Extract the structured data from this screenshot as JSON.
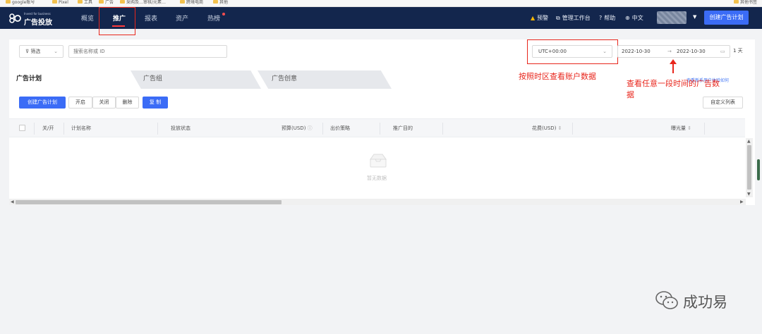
{
  "bookmarks": [
    "google账号",
    "Pixel",
    "工具",
    "广告",
    "采购及…审核/元素…",
    "跨境电商",
    "其他"
  ],
  "bookmarks_right": "其他书签",
  "logo": {
    "tagline": "Invest for business",
    "name": "广告投放"
  },
  "nav": {
    "items": [
      "概览",
      "推广",
      "报表",
      "资产",
      "热榜"
    ],
    "active": "推广",
    "right": {
      "alert": "预警",
      "workbench": "管理工作台",
      "help": "帮助",
      "language": "中文"
    },
    "create_button": "创建广告计划"
  },
  "filter": {
    "filter_label": "筛选",
    "search_placeholder": "搜索名称或 ID",
    "timezone": "UTC+00:00",
    "date_start": "2022-10-30",
    "date_sep": "→",
    "date_end": "2022-10-30",
    "days": "1 天"
  },
  "annotations": {
    "timezone_note": "按照时区查看账户数据",
    "date_note_line1": "查看任意一段时间的广告数",
    "date_note_line2": "据"
  },
  "tabs": [
    "广告计划",
    "广告组",
    "广告创意"
  ],
  "help_link": "查看新手用户体验如何",
  "toolbar": {
    "create": "创建广告计划",
    "enable": "开启",
    "disable": "关闭",
    "delete": "删除",
    "copy": "复 制",
    "customize": "自定义列表"
  },
  "table": {
    "columns": [
      "关/开",
      "计划名称",
      "投放状态",
      "预算(USD)",
      "出价策略",
      "推广目的",
      "花费(USD)",
      "曝光量"
    ],
    "empty_text": "暂无数据"
  },
  "watermark": "成功易",
  "colors": {
    "nav_bg": "#13264d",
    "primary": "#3b6cf6",
    "annotation": "#e8261c"
  }
}
